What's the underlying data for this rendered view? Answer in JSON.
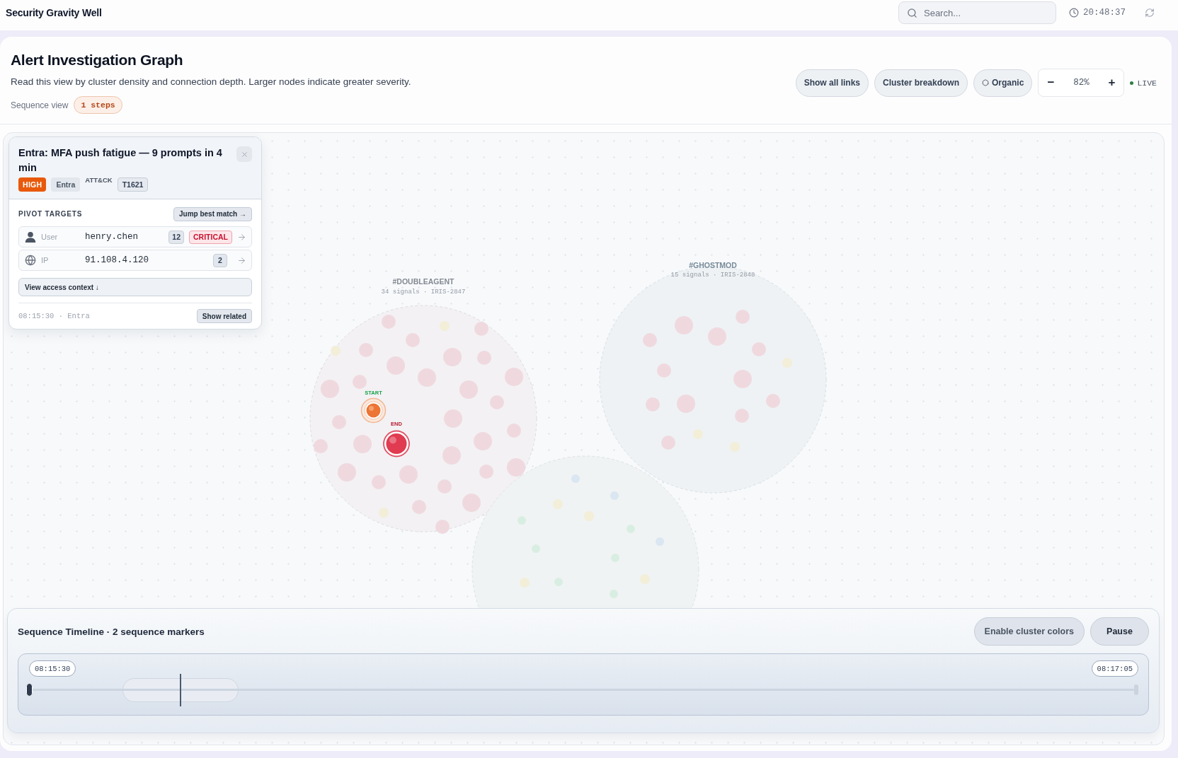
{
  "app": {
    "title": "Security Gravity Well"
  },
  "top_bar": {
    "search": {
      "placeholder": "Search..."
    },
    "clock": "20:48:37"
  },
  "header": {
    "title": "Alert Investigation Graph",
    "subtitle": "Read this view by cluster density and connection depth. Larger nodes indicate greater severity.",
    "sequence_label": "Sequence view",
    "steps_badge": "1 steps",
    "buttons": [
      {
        "label": "Show all links",
        "kind": "plain"
      },
      {
        "label": "Cluster breakdown",
        "kind": "plain"
      },
      {
        "label": "Organic",
        "kind": "layout"
      }
    ],
    "zoom": {
      "minus": "−",
      "value": "82%",
      "plus": "+"
    },
    "live_label": "LIVE"
  },
  "graph": {
    "clusters": [
      {
        "name": "#DOUBLEAGENT",
        "meta": "34 signals · IRIS-2847",
        "markers": [
          {
            "kind": "start",
            "label": "START"
          },
          {
            "kind": "end",
            "label": "END"
          }
        ]
      },
      {
        "name": "#GHOSTMOD",
        "meta": "15 signals · IRIS-2848"
      }
    ],
    "alert_card": {
      "title": "Entra: MFA push fatigue — 9 prompts in 4 min",
      "severity": "HIGH",
      "source": "Entra",
      "framework": "ATT&CK",
      "technique": "T1621",
      "pivot_heading": "PIVOT TARGETS",
      "jump_button": "Jump best match →",
      "targets": [
        {
          "kind": "user",
          "type_label": "User",
          "value": "henry.chen",
          "count": "12",
          "severity": "CRITICAL"
        },
        {
          "kind": "ip",
          "type_label": "IP",
          "value": "91.108.4.120",
          "count": "2"
        }
      ],
      "context_button": "View access context ↓",
      "footer_meta": "08:15:30 · Entra",
      "related_button": "Show related"
    },
    "timeline": {
      "title": "Sequence Timeline · 2 sequence markers",
      "buttons": [
        {
          "label": "Enable cluster colors"
        },
        {
          "label": "Pause"
        }
      ],
      "start_time": "08:15:30",
      "end_time": "08:17:05",
      "level": 0.134
    }
  }
}
